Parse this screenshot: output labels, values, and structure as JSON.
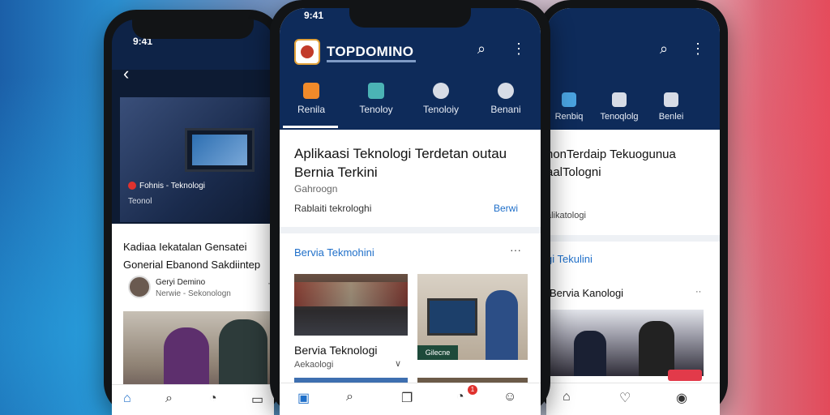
{
  "left_phone": {
    "time": "9:41",
    "hero_caption": "Fohnis - Teknologi",
    "hero_sub": "Teonol",
    "article_title": "Kadiaa Iekatalan  Gensatei Gonerial Ebanond Sakdiintep",
    "author_name": "Geryi Demino",
    "author_category": "Nerwie - Sekonologn",
    "more": "···"
  },
  "middle_phone": {
    "time": "9:41",
    "app_title": "TOPDOMINO",
    "tabs": [
      "Renila",
      "Tenoloy",
      "Tenoloiy",
      "Benani"
    ],
    "article_title": "Aplikaasi Teknologi Terdetan outau Bernia Terkini",
    "article_category": "Gahroogn",
    "article_subtitle": "Rablaiti tekrologhi",
    "article_more": "Berwi",
    "section_title": "Bervia Tekmohini",
    "section_more": "···",
    "card_title": "Bervia Teknologi",
    "card_subtitle": "Aekaologi",
    "card_badge": "Gilecne",
    "notif_count": "1"
  },
  "right_phone": {
    "tabs": [
      "Renbiq",
      "Tenoqlolg",
      "Benlei"
    ],
    "article_title": "honTerdaip Tekuogunua aalTologni",
    "article_category": "alikatologi",
    "section_title": "gi Tekulini",
    "sub_title": "Bervia Kanologi",
    "more": "··"
  }
}
